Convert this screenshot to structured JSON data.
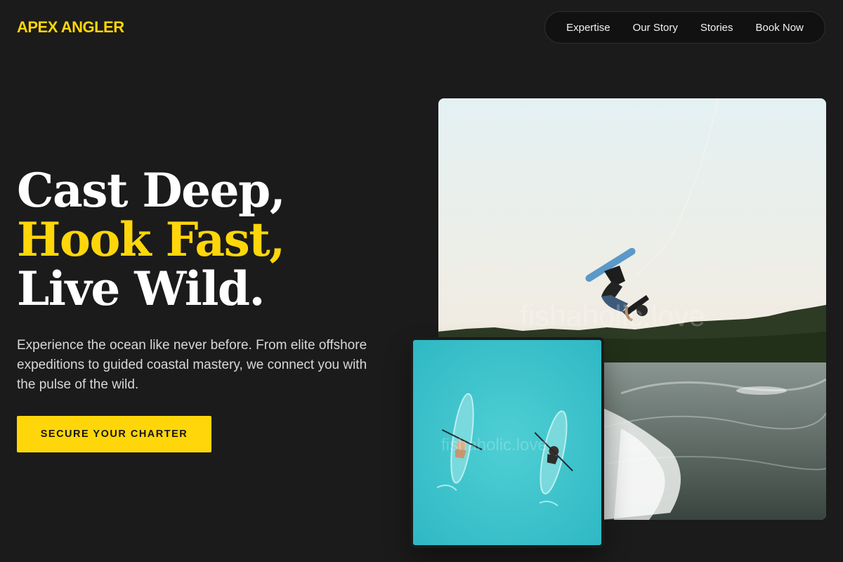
{
  "brand": {
    "logo": "APEX ANGLER",
    "accent_color": "#ffd60a",
    "background_color": "#1b1b1b"
  },
  "nav": {
    "items": [
      {
        "label": "Expertise"
      },
      {
        "label": "Our Story"
      },
      {
        "label": "Stories"
      },
      {
        "label": "Book Now"
      }
    ]
  },
  "hero": {
    "headline_line1": "Cast Deep,",
    "headline_line2": "Hook Fast,",
    "headline_line3": "Live Wild.",
    "description": "Experience the ocean like never before. From elite offshore expeditions to guided coastal mastery, we connect you with the pulse of the wild.",
    "cta_label": "SECURE YOUR CHARTER"
  },
  "media": {
    "main_photo_watermark": "fishaholic.love",
    "small_photo_watermark": "fishaholic.love"
  }
}
